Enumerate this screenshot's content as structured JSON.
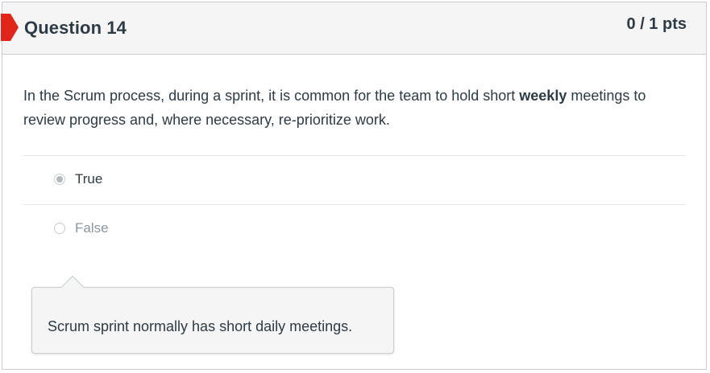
{
  "question": {
    "title": "Question 14",
    "points": "0 / 1 pts",
    "text_before": "In the Scrum process, during a sprint, it is common for the team to hold short ",
    "text_bold": "weekly",
    "text_after": " meetings to review progress and, where necessary, re-prioritize work."
  },
  "answers": [
    {
      "label": "True",
      "selected": true
    },
    {
      "label": "False",
      "selected": false
    }
  ],
  "feedback": {
    "text": "Scrum sprint normally has short daily meetings."
  },
  "colors": {
    "flag": "#e0261b",
    "header_bg": "#f5f5f5",
    "text": "#2d3b45",
    "muted_text": "#8b969e"
  }
}
